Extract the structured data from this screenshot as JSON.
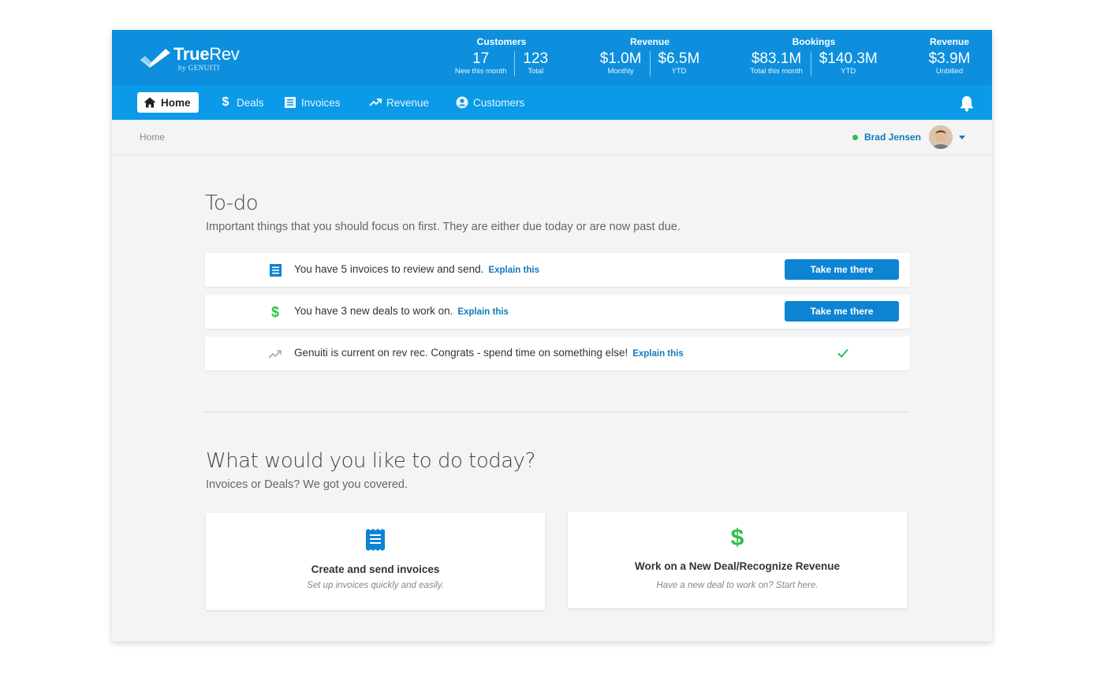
{
  "brand": {
    "name_bold": "True",
    "name_light": "Rev",
    "byline": "by GENUITI",
    "color": "#0d8fdd"
  },
  "metrics": [
    {
      "title": "Customers",
      "items": [
        {
          "value": "17",
          "label": "New this month"
        },
        {
          "value": "123",
          "label": "Total"
        }
      ]
    },
    {
      "title": "Revenue",
      "items": [
        {
          "value": "$1.0M",
          "label": "Monthly"
        },
        {
          "value": "$6.5M",
          "label": "YTD"
        }
      ]
    },
    {
      "title": "Bookings",
      "items": [
        {
          "value": "$83.1M",
          "label": "Total this month"
        },
        {
          "value": "$140.3M",
          "label": "YTD"
        }
      ]
    },
    {
      "title": "Revenue",
      "items": [
        {
          "value": "$3.9M",
          "label": "Unbilled"
        }
      ]
    }
  ],
  "nav": {
    "items": [
      {
        "label": "Home",
        "icon": "home-icon",
        "active": true
      },
      {
        "label": "Deals",
        "icon": "dollar-icon"
      },
      {
        "label": "Invoices",
        "icon": "invoice-icon"
      },
      {
        "label": "Revenue",
        "icon": "trending-up-icon"
      },
      {
        "label": "Customers",
        "icon": "account-circle-icon"
      }
    ],
    "bell_icon": "bell-icon"
  },
  "breadcrumb": {
    "current": "Home"
  },
  "user": {
    "name": "Brad Jensen",
    "status": "online",
    "status_color": "#2fbf4a"
  },
  "todo": {
    "title": "To-do",
    "subtitle": "Important things that you should focus on first. They are either due today or are now past due.",
    "items": [
      {
        "icon": "invoice-icon",
        "text": "You have 5 invoices to review and send.",
        "link": "Explain this",
        "action": "Take me there"
      },
      {
        "icon": "dollar-icon",
        "text": "You have 3 new deals to work on.",
        "link": "Explain this",
        "action": "Take me there"
      },
      {
        "icon": "trending-up-icon",
        "text": "Genuiti is current on rev rec. Congrats - spend time on something else!",
        "link": "Explain this",
        "action": "done"
      }
    ]
  },
  "today": {
    "title": "What would you like to do today?",
    "subtitle": "Invoices or Deals? We got you covered.",
    "cards": [
      {
        "icon": "invoice-icon",
        "title": "Create and send invoices",
        "subtitle": "Set up invoices quickly and easily."
      },
      {
        "icon": "dollar-icon",
        "title": "Work on a New Deal/Recognize Revenue",
        "subtitle": "Have a new deal to work on? Start here."
      }
    ]
  },
  "colors": {
    "accent": "#0d8fdd",
    "nav": "#0a9ae8",
    "link": "#1279bf",
    "success": "#2fbf4a",
    "button": "#0d84d3"
  }
}
